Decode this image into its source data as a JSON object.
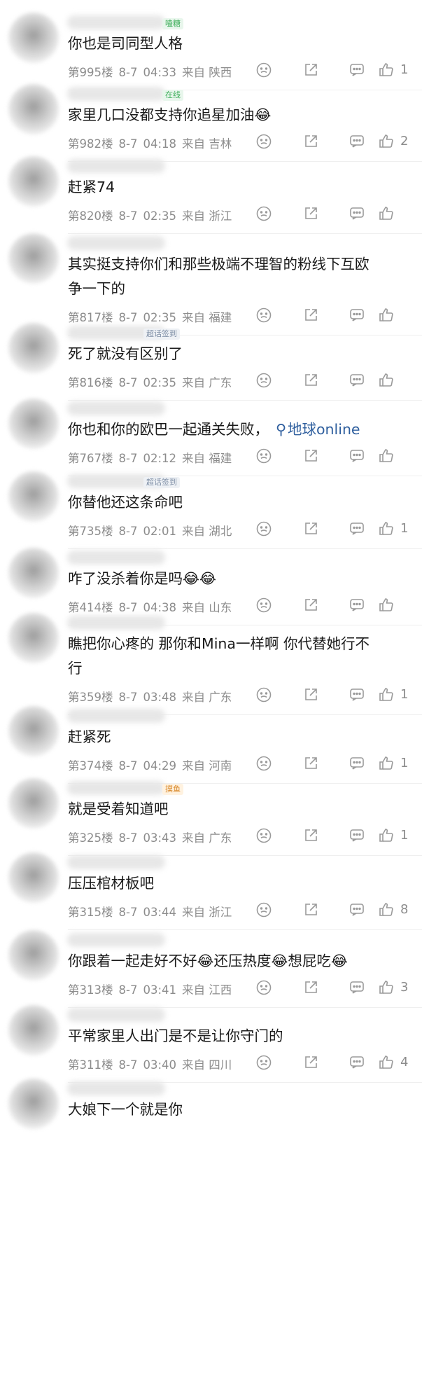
{
  "comments": [
    {
      "badge": "嗑糖",
      "text": "你也是司同型人格",
      "floor": "第995楼",
      "date": "8-7",
      "time": "04:33",
      "location": "来自 陕西",
      "likes": "1"
    },
    {
      "badge": "在线",
      "text": "家里几口没都支持你追星加油😂",
      "floor": "第982楼",
      "date": "8-7",
      "time": "04:18",
      "location": "来自 吉林",
      "likes": "2"
    },
    {
      "badge": "",
      "text": "赶紧74",
      "floor": "第820楼",
      "date": "8-7",
      "time": "02:35",
      "location": "来自 浙江",
      "likes": ""
    },
    {
      "badge": "",
      "text": "其实挺支持你们和那些极端不理智的粉线下互欧\n争一下的",
      "floor": "第817楼",
      "date": "8-7",
      "time": "02:35",
      "location": "来自 福建",
      "likes": ""
    },
    {
      "badge": "超话签到",
      "text": "死了就没有区别了",
      "floor": "第816楼",
      "date": "8-7",
      "time": "02:35",
      "location": "来自 广东",
      "likes": ""
    },
    {
      "badge": "",
      "text": "你也和你的欧巴一起通关失败，",
      "link": "地球online",
      "floor": "第767楼",
      "date": "8-7",
      "time": "02:12",
      "location": "来自 福建",
      "likes": ""
    },
    {
      "badge": "超话签到",
      "text": "你替他还这条命吧",
      "floor": "第735楼",
      "date": "8-7",
      "time": "02:01",
      "location": "来自 湖北",
      "likes": "1"
    },
    {
      "badge": "",
      "text": "咋了没杀着你是吗😂😂",
      "floor": "第414楼",
      "date": "8-7",
      "time": "04:38",
      "location": "来自 山东",
      "likes": ""
    },
    {
      "badge": "",
      "text": "瞧把你心疼的 那你和Mina一样啊 你代替她行不\n行",
      "floor": "第359楼",
      "date": "8-7",
      "time": "03:48",
      "location": "来自 广东",
      "likes": "1"
    },
    {
      "badge": "",
      "text": "赶紧死",
      "floor": "第374楼",
      "date": "8-7",
      "time": "04:29",
      "location": "来自 河南",
      "likes": "1"
    },
    {
      "badge": "摸鱼",
      "text": "就是受着知道吧",
      "floor": "第325楼",
      "date": "8-7",
      "time": "03:43",
      "location": "来自 广东",
      "likes": "1"
    },
    {
      "badge": "",
      "text": "压压棺材板吧",
      "floor": "第315楼",
      "date": "8-7",
      "time": "03:44",
      "location": "来自 浙江",
      "likes": "8"
    },
    {
      "badge": "",
      "text": "你跟着一起走好不好😂还压热度😂想屁吃😂",
      "floor": "第313楼",
      "date": "8-7",
      "time": "03:41",
      "location": "来自 江西",
      "likes": "3"
    },
    {
      "badge": "",
      "text": "平常家里人出门是不是让你守门的",
      "floor": "第311楼",
      "date": "8-7",
      "time": "03:40",
      "location": "来自 四川",
      "likes": "4"
    },
    {
      "badge": "",
      "text": "大娘下一个就是你",
      "floor": "",
      "date": "",
      "time": "",
      "location": "",
      "likes": ""
    }
  ],
  "colors": {
    "badge_green": "#3fae5b",
    "badge_gray": "#7f8fa6",
    "link": "#2f5f9e",
    "meta": "#8c8c8c"
  },
  "icons": [
    "reply-icon",
    "share-icon",
    "comment-icon",
    "like-icon"
  ]
}
